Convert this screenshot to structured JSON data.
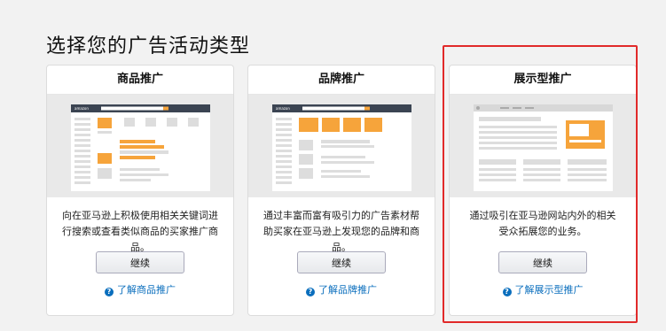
{
  "page_title": "选择您的广告活动类型",
  "cards": [
    {
      "title": "商品推广",
      "description": "向在亚马逊上积极使用相关关键词进行搜索或查看类似商品的买家推广商品。",
      "button_label": "继续",
      "help_link": "了解商品推广",
      "preview_brand": "amazon"
    },
    {
      "title": "品牌推广",
      "description": "通过丰富而富有吸引力的广告素材帮助买家在亚马逊上发现您的品牌和商品。",
      "button_label": "继续",
      "help_link": "了解品牌推广",
      "preview_brand": "amazon"
    },
    {
      "title": "展示型推广",
      "description": "通过吸引在亚马逊网站内外的相关受众拓展您的业务。",
      "button_label": "继续",
      "help_link": "了解展示型推广"
    }
  ],
  "colors": {
    "accent": "#f6a43b",
    "highlight_border": "#e12a2a",
    "link": "#0a6ebd"
  },
  "icons": {
    "help": "question-circle-icon",
    "help_glyph": "?"
  }
}
